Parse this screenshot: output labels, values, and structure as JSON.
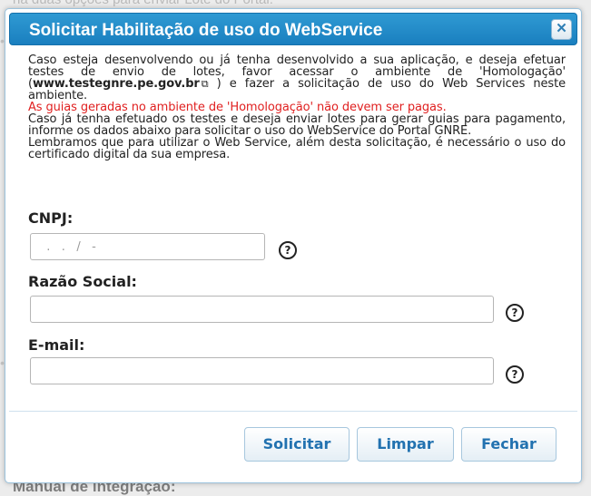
{
  "background": {
    "top_text": "na duas opções para enviar Lote do Portal:",
    "bottom_text": "Manual de integração:"
  },
  "dialog": {
    "title": "Solicitar Habilitação de uso do WebService",
    "close_icon": "close-icon",
    "info": {
      "line1_pre": "Caso esteja desenvolvendo ou já tenha desenvolvido a sua aplicação, e deseja efetuar testes de envio de lotes, favor acessar o ambiente de 'Homologação' (",
      "link": "www.testegnre.pe.gov.br",
      "line1_post": " ) e fazer a solicitação de uso do Web Services neste ambiente.",
      "warning": "As guias geradas no ambiente de 'Homologação' não devem ser pagas.",
      "line2": "Caso já tenha efetuado os testes e deseja enviar lotes para gerar guias para pagamento, informe os dados abaixo para solicitar o uso do WebService do Portal GNRE.",
      "line3": "Lembramos que para utilizar o Web Service, além desta solicitação, é necessário o uso do certificado digital da sua empresa."
    },
    "fields": {
      "cnpj": {
        "label": "CNPJ:",
        "value": "",
        "placeholder": "  .   .   /   -"
      },
      "razao": {
        "label": "Razão Social:",
        "value": "",
        "placeholder": ""
      },
      "email": {
        "label": "E-mail:",
        "value": "",
        "placeholder": ""
      }
    },
    "help_glyph": "?",
    "buttons": {
      "solicitar": "Solicitar",
      "limpar": "Limpar",
      "fechar": "Fechar"
    },
    "colors": {
      "title_bar": "#1f88c6",
      "warning": "#e02020",
      "button_text": "#2272b0"
    }
  }
}
